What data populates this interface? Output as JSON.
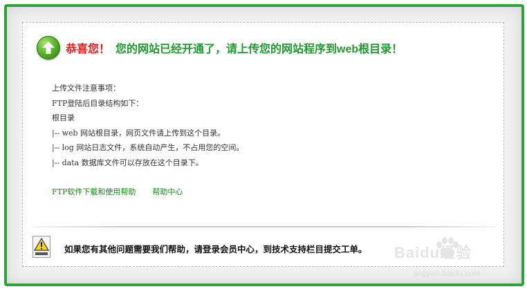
{
  "header": {
    "icon": "up-arrow-icon",
    "congrats": "恭喜您！",
    "message": "您的网站已经开通了，请上传您的网站程序到web根目录！"
  },
  "notes": {
    "lines": [
      "上传文件注意事项：",
      "FTP登陆后目录结构如下：",
      "根目录",
      "|-- web 网站根目录，网页文件请上传到这个目录。",
      "|-- log 网站日志文件，系统自动产生，不占用您的空间。",
      "|-- data 数据库文件可以存放在这个目录下。"
    ]
  },
  "links": {
    "ftp_help": "FTP软件下载和使用帮助",
    "help_center": "帮助中心"
  },
  "footer": {
    "icon": "warning-icon",
    "text": "如果您有其他问题需要我们帮助，请登录会员中心，到技术支持栏目提交工单。"
  },
  "watermark": {
    "brand": "Baidu经验",
    "url": "jingyan.baidu.com"
  },
  "colors": {
    "frame_border": "#2da337",
    "congrats_red": "#e21b1b",
    "message_green": "#1f9a2e",
    "link_green": "#168a16"
  }
}
